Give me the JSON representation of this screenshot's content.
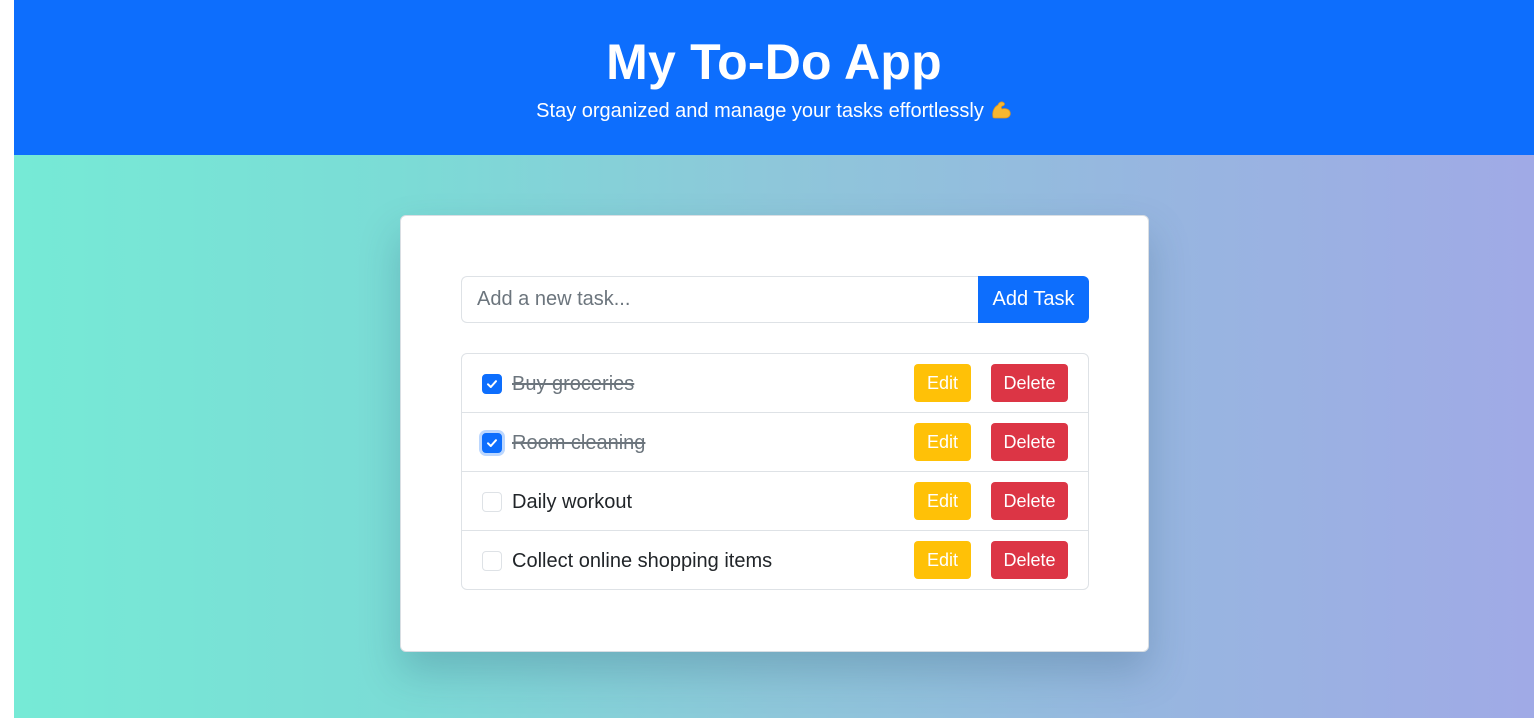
{
  "header": {
    "title": "My To-Do App",
    "subtitle": "Stay organized and manage your tasks effortlessly",
    "subtitle_icon": "flexed-biceps-icon"
  },
  "form": {
    "placeholder": "Add a new task...",
    "value": "",
    "add_label": "Add Task"
  },
  "tasks": [
    {
      "text": "Buy groceries",
      "completed": true,
      "focused": false,
      "edit_label": "Edit",
      "delete_label": "Delete"
    },
    {
      "text": "Room cleaning",
      "completed": true,
      "focused": true,
      "edit_label": "Edit",
      "delete_label": "Delete"
    },
    {
      "text": "Daily workout",
      "completed": false,
      "focused": false,
      "edit_label": "Edit",
      "delete_label": "Delete"
    },
    {
      "text": "Collect online shopping items",
      "completed": false,
      "focused": false,
      "edit_label": "Edit",
      "delete_label": "Delete"
    }
  ],
  "colors": {
    "primary": "#0d6efd",
    "warning": "#ffc107",
    "danger": "#dc3545",
    "muted": "#6c757d"
  }
}
